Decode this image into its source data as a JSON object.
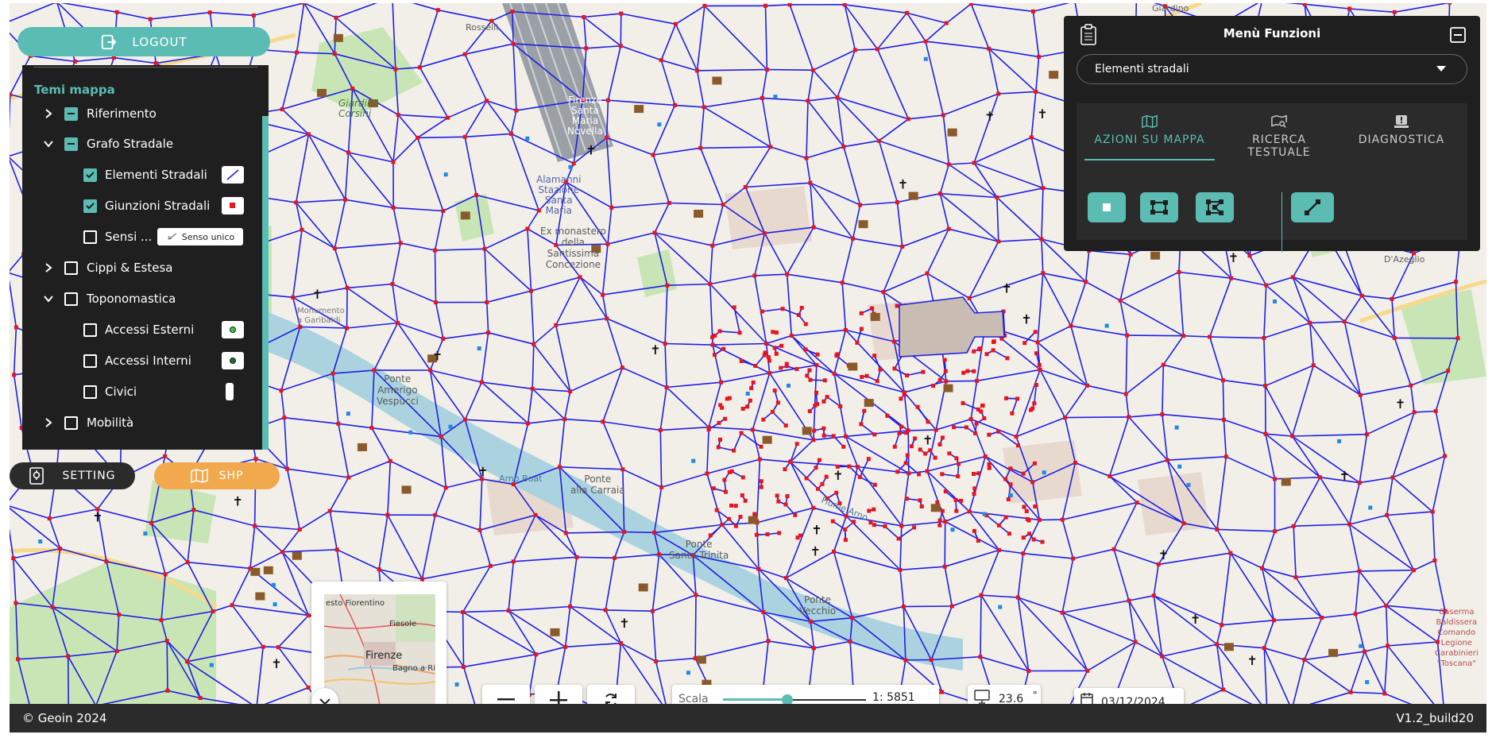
{
  "map": {
    "labels": [
      {
        "text": "Giardino\nCorsini"
      },
      {
        "text": "Firenze\nSanta\nMaria\nNovella"
      },
      {
        "text": "Alamanni\nStazione\nSanta\nMaria"
      },
      {
        "text": "Ex monastero\ndella\nSantissima\nConcezione"
      },
      {
        "text": "Ponte\nAmerigo\nVespucci"
      },
      {
        "text": "Ponte\nalla Carraia"
      },
      {
        "text": "Ponte\nSanta Trinita"
      },
      {
        "text": "Ponte\nVecchio"
      },
      {
        "text": "Monumento\na Garibaldi"
      },
      {
        "text": "Fiume Arno"
      },
      {
        "text": "Arno Boat"
      },
      {
        "text": "Caserma\nBaldissera\nComando\nLegione\nCarabinieri\n\"Toscana\""
      },
      {
        "text": "Giardino"
      },
      {
        "text": "Rosselli"
      },
      {
        "text": "D'Azeglio"
      }
    ]
  },
  "logout": {
    "label": "LOGOUT"
  },
  "layers": {
    "title": "Temi mappa",
    "items": [
      {
        "label": "Riferimento"
      },
      {
        "label": "Grafo Stradale"
      },
      {
        "label": "Elementi Stradali"
      },
      {
        "label": "Giunzioni Stradali"
      },
      {
        "label": "Sensi ..."
      },
      {
        "label": "Cippi & Estesa"
      },
      {
        "label": "Toponomastica"
      },
      {
        "label": "Accessi Esterni"
      },
      {
        "label": "Accessi Interni"
      },
      {
        "label": "Civici"
      },
      {
        "label": "Mobilità"
      }
    ],
    "senso_unico_label": "Senso unico"
  },
  "setting": {
    "label": "SETTING"
  },
  "shp": {
    "label": "SHP"
  },
  "menu": {
    "title": "Menù Funzioni",
    "select_value": "Elementi stradali",
    "tabs": [
      {
        "label": "AZIONI SU MAPPA"
      },
      {
        "label": "RICERCA TESTUALE"
      },
      {
        "label": "DIAGNOSTICA"
      }
    ]
  },
  "minimap": {
    "labels": [
      "esto Fiorentino",
      "Fiesole",
      "Firenze",
      "Bagno a Rip"
    ]
  },
  "scale": {
    "label": "Scala",
    "ratio": "1: 5851",
    "slider_fraction": 0.45
  },
  "dpi": {
    "value": "23.6",
    "unit": "\""
  },
  "date": {
    "value": "03/12/2024"
  },
  "footer": {
    "copyright": "© Geoin 2024",
    "version": "V1.2_build20"
  }
}
